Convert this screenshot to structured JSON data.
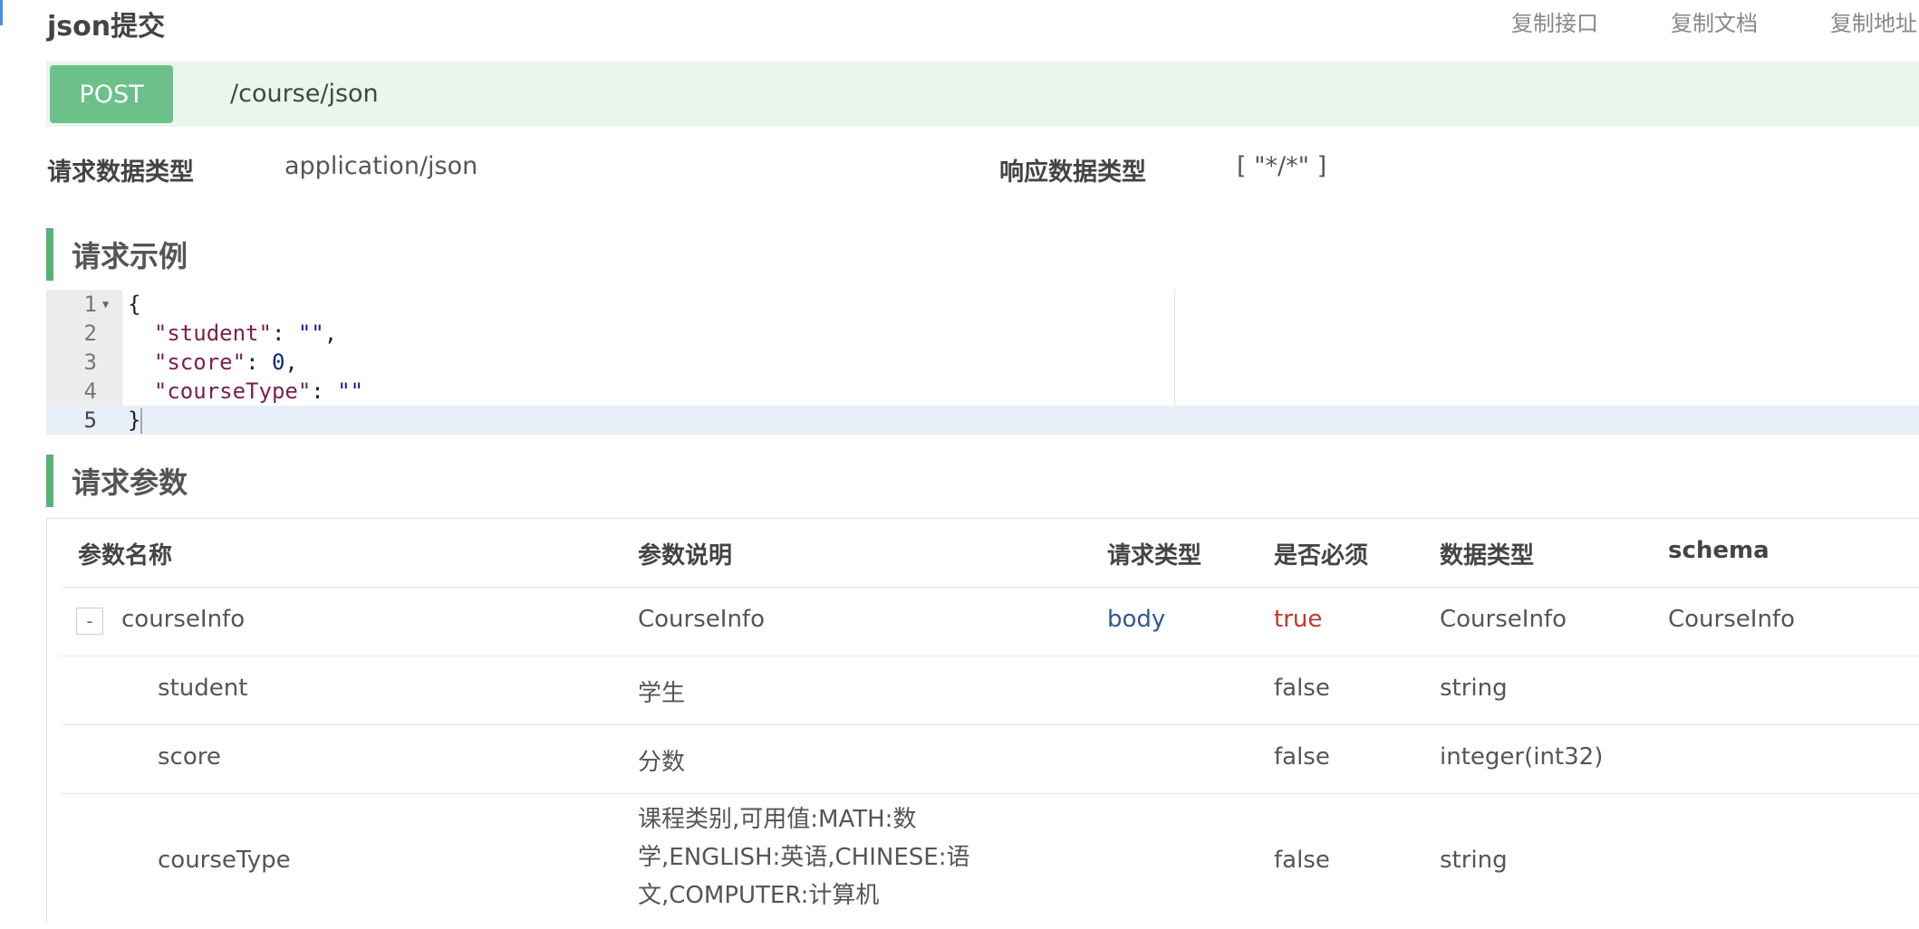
{
  "header": {
    "title": "json提交",
    "actions": [
      "复制接口",
      "复制文档",
      "复制地址"
    ]
  },
  "endpoint": {
    "method": "POST",
    "path": "/course/json"
  },
  "meta": {
    "request_type_label": "请求数据类型",
    "request_type_value": "application/json",
    "response_type_label": "响应数据类型",
    "response_type_value": "[ \"*/*\" ]"
  },
  "sections": {
    "example": "请求示例",
    "params": "请求参数"
  },
  "example_code": {
    "line_numbers": [
      "1",
      "2",
      "3",
      "4",
      "5"
    ],
    "open_brace": "{",
    "close_brace": "}",
    "fields": [
      {
        "key": "\"student\"",
        "sep": ": ",
        "value": "\"\"",
        "tail": ","
      },
      {
        "key": "\"score\"",
        "sep": ": ",
        "value": "0",
        "tail": ","
      },
      {
        "key": "\"courseType\"",
        "sep": ": ",
        "value": "\"\"",
        "tail": ""
      }
    ]
  },
  "params_table": {
    "headers": [
      "参数名称",
      "参数说明",
      "请求类型",
      "是否必须",
      "数据类型",
      "schema"
    ],
    "rows": [
      {
        "toggle": "-",
        "name": "courseInfo",
        "desc": "CourseInfo",
        "in": "body",
        "required": "true",
        "type": "CourseInfo",
        "schema": "CourseInfo"
      },
      {
        "name": "student",
        "desc": "学生",
        "in": "",
        "required": "false",
        "type": "string",
        "schema": ""
      },
      {
        "name": "score",
        "desc": "分数",
        "in": "",
        "required": "false",
        "type": "integer(int32)",
        "schema": ""
      },
      {
        "name": "courseType",
        "desc": "课程类别,可用值:MATH:数学,ENGLISH:英语,CHINESE:语文,COMPUTER:计算机",
        "desc_lines": [
          "课程类别,可用值:MATH:数",
          "学,ENGLISH:英语,CHINESE:语",
          "文,COMPUTER:计算机"
        ],
        "in": "",
        "required": "false",
        "type": "string",
        "schema": ""
      }
    ]
  },
  "colors": {
    "method_bg": "#6cc18a",
    "endpoint_bg": "#e9f6ee",
    "section_accent": "#58b177",
    "link_blue": "#2f5a93",
    "required_red": "#c0392b"
  }
}
